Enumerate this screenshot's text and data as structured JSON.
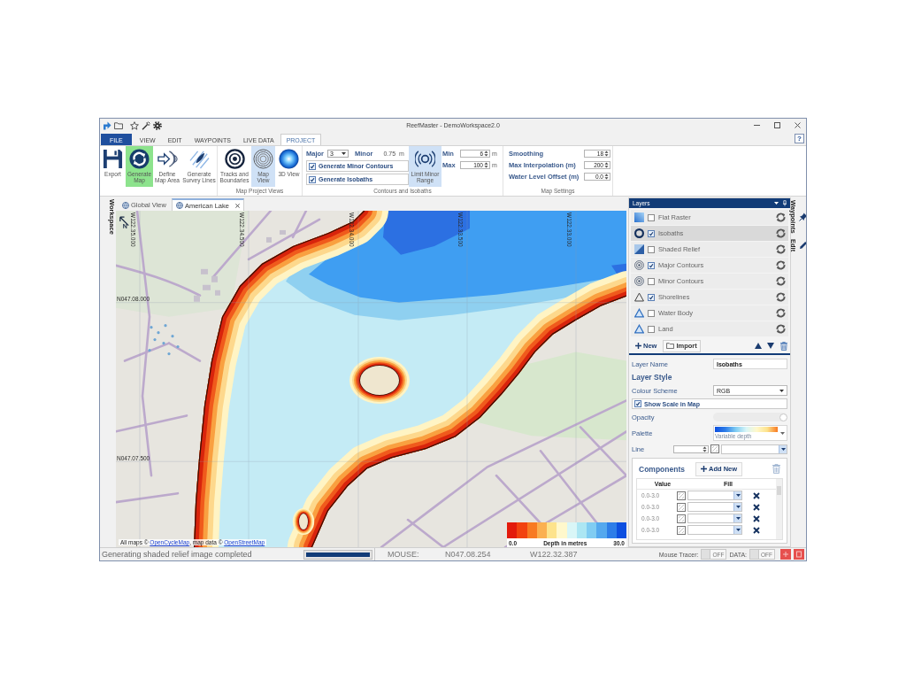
{
  "window": {
    "title": "ReefMaster - DemoWorkspace2.0"
  },
  "menu_tabs": [
    {
      "label": "FILE",
      "kind": "file",
      "selected": false
    },
    {
      "label": "VIEW",
      "kind": "tab",
      "selected": false
    },
    {
      "label": "EDIT",
      "kind": "tab",
      "selected": false
    },
    {
      "label": "WAYPOINTS",
      "kind": "tab",
      "selected": false
    },
    {
      "label": "LIVE DATA",
      "kind": "tab",
      "selected": false
    },
    {
      "label": "PROJECT",
      "kind": "tab",
      "selected": true
    }
  ],
  "help_button": "?",
  "ribbon": {
    "actions": [
      {
        "label": "Export",
        "kind": "export",
        "active": false
      },
      {
        "label": "Generate Map",
        "kind": "generate",
        "active": true
      },
      {
        "label": "Define Map Area",
        "kind": "define_area",
        "active": false
      },
      {
        "label": "Generate Survey Lines",
        "kind": "survey_lines",
        "active": false
      }
    ],
    "views": {
      "title": "Map Project Views",
      "items": [
        {
          "label": "Tracks and Boundaries",
          "kind": "tracks",
          "selected": false
        },
        {
          "label": "Map View",
          "kind": "map",
          "selected": true
        },
        {
          "label": "3D View",
          "kind": "view_3d",
          "selected": false
        }
      ]
    },
    "contours": {
      "title": "Contours and Isobaths",
      "major_label": "Major",
      "major_value": "3",
      "minor_label": "Minor",
      "minor_value": "0.75",
      "minor_unit": "m",
      "options": [
        {
          "label": "Generate Minor Contours",
          "checked": true
        },
        {
          "label": "Generate Isobaths",
          "checked": true
        }
      ],
      "limit_button": {
        "label": "Limit Minor Range",
        "on": true
      },
      "range": [
        {
          "label": "Min",
          "value": "6",
          "unit": "m"
        },
        {
          "label": "Max",
          "value": "100",
          "unit": "m"
        }
      ]
    },
    "map_settings": {
      "title": "Map Settings",
      "fields": [
        {
          "label": "Smoothing",
          "value": "18"
        },
        {
          "label": "Max Interpolation (m)",
          "value": "200"
        },
        {
          "label": "Water Level Offset (m)",
          "value": "0.0"
        }
      ]
    }
  },
  "workspace_tab": "Workspace",
  "doc_tabs": [
    {
      "label": "Global View",
      "selected": false,
      "closable": false
    },
    {
      "label": "American Lake",
      "selected": true,
      "closable": true
    }
  ],
  "map": {
    "lat_labels": [
      "N047.08.000",
      "N047.07.500"
    ],
    "lon_labels": [
      "W122.35.000",
      "W122.34.500",
      "W122.34.000",
      "W122.33.500",
      "W122.33.000"
    ],
    "attribution": {
      "prefix": "All maps © ",
      "link_1": "OpenCycleMap",
      "middle": ", map data © ",
      "link_2": "OpenStreetMap"
    },
    "legend": {
      "min": "0.0",
      "title": "Depth in metres",
      "max": "30.0",
      "swatches": [
        {
          "color": "#e31a0b"
        },
        {
          "color": "#f2420f"
        },
        {
          "color": "#f87a22"
        },
        {
          "color": "#fbb050"
        },
        {
          "color": "#fde38c"
        },
        {
          "color": "#fff8cc"
        },
        {
          "color": "#d9f6f7"
        },
        {
          "color": "#ace6f3"
        },
        {
          "color": "#80ccf2"
        },
        {
          "color": "#54a8ee"
        },
        {
          "color": "#2d7de8"
        },
        {
          "color": "#0d4fe0"
        }
      ]
    }
  },
  "layers_panel": {
    "title": "Layers",
    "layers": [
      {
        "name": "Flat Raster",
        "kind": "raster",
        "checked": false,
        "selected": false
      },
      {
        "name": "Isobaths",
        "kind": "isobaths",
        "checked": true,
        "selected": true
      },
      {
        "name": "Shaded Relief",
        "kind": "relief",
        "checked": false,
        "selected": false
      },
      {
        "name": "Major Contours",
        "kind": "contours",
        "checked": true,
        "selected": false
      },
      {
        "name": "Minor Contours",
        "kind": "contours",
        "checked": false,
        "selected": false
      },
      {
        "name": "Shorelines",
        "kind": "shoreline",
        "checked": true,
        "selected": false
      },
      {
        "name": "Water Body",
        "kind": "area",
        "checked": false,
        "selected": false
      },
      {
        "name": "Land",
        "kind": "area",
        "checked": false,
        "selected": false
      }
    ],
    "new_button": "New",
    "import_button": "Import",
    "properties": {
      "layer_name_label": "Layer Name",
      "layer_name": "Isobaths",
      "style_heading": "Layer Style",
      "scheme_label": "Colour Scheme",
      "scheme": "RGB",
      "show_scale": {
        "label": "Show Scale in Map",
        "checked": true
      },
      "opacity_label": "Opacity",
      "opacity": {
        "level": 1
      },
      "palette_label": "Palette",
      "palette_name": "Variable depth",
      "line_label": "Line"
    },
    "components": {
      "title": "Components",
      "add_button": "Add New",
      "columns": [
        "Value",
        "Fill"
      ],
      "rows": [
        {
          "value": "0.0-3.0"
        },
        {
          "value": "0.0-3.0"
        },
        {
          "value": "0.0-3.0"
        },
        {
          "value": "0.0-3.0"
        }
      ]
    }
  },
  "side_tabs": [
    {
      "label": "Waypoints"
    },
    {
      "label": "Edit"
    }
  ],
  "status_bar": {
    "message": "Generating shaded relief image completed",
    "progress": {
      "level": 1
    },
    "mouse_label": "MOUSE:",
    "lat": "N047.08.254",
    "lon": "W122.32.387",
    "toggles": [
      {
        "label": "Mouse Tracer:",
        "state": "OFF",
        "on": false
      },
      {
        "label": "DATA:",
        "state": "OFF",
        "on": false
      }
    ]
  }
}
